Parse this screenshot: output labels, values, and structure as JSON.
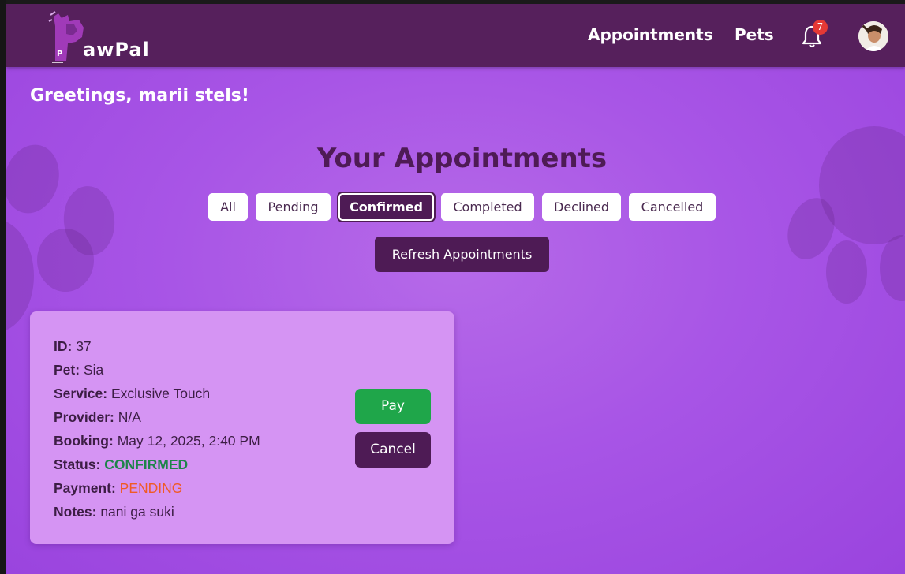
{
  "brand": {
    "name": "awPal",
    "logo_letter": "P"
  },
  "nav": {
    "appointments_label": "Appointments",
    "pets_label": "Pets",
    "notification_count": "7"
  },
  "greeting": "Greetings, marii stels!",
  "page_title": "Your Appointments",
  "filters": [
    {
      "label": "All",
      "active": false
    },
    {
      "label": "Pending",
      "active": false
    },
    {
      "label": "Confirmed",
      "active": true
    },
    {
      "label": "Completed",
      "active": false
    },
    {
      "label": "Declined",
      "active": false
    },
    {
      "label": "Cancelled",
      "active": false
    }
  ],
  "refresh_label": "Refresh Appointments",
  "appointment": {
    "id_label": "ID:",
    "id": "37",
    "pet_label": "Pet:",
    "pet": "Sia",
    "service_label": "Service:",
    "service": "Exclusive Touch",
    "provider_label": "Provider:",
    "provider": "N/A",
    "booking_label": "Booking:",
    "booking": "May 12, 2025, 2:40 PM",
    "status_label": "Status:",
    "status": "CONFIRMED",
    "payment_label": "Payment:",
    "payment": "PENDING",
    "notes_label": "Notes:",
    "notes": "nani ga suki",
    "pay_label": "Pay",
    "cancel_label": "Cancel"
  },
  "colors": {
    "navbar": "#56205c",
    "accent_dark": "#4e1b55",
    "background": "#a855e6",
    "card": "#d594f3",
    "pay_button": "#1fa64a",
    "status_confirmed": "#1e8449",
    "payment_pending": "#f05a24",
    "badge": "#e53935"
  }
}
